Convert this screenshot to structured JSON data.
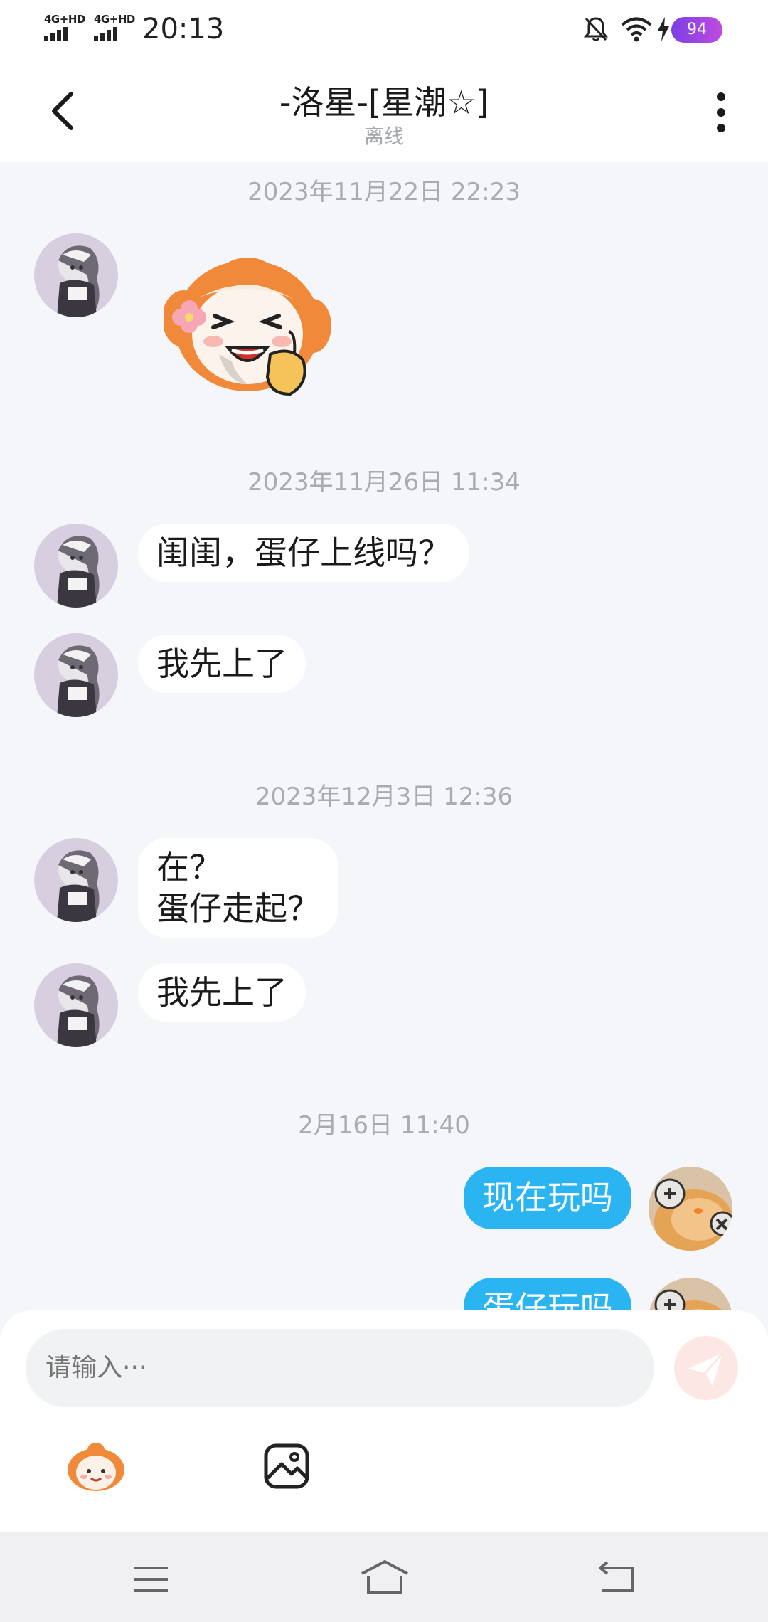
{
  "status_bar": {
    "network_1": "4G+HD",
    "network_2": "4G+HD",
    "time": "20:13",
    "battery": "94",
    "icons": [
      "bell-off-icon",
      "wifi-icon",
      "bolt-icon",
      "battery-icon"
    ]
  },
  "header": {
    "title": "-洛星-[星潮☆]",
    "subtitle": "离线",
    "back_icon": "chevron-left-icon",
    "more_icon": "more-vertical-icon"
  },
  "timestamps": [
    "2023年11月22日 22:23",
    "2023年11月26日 11:34",
    "2023年12月3日 12:36",
    "2月16日 11:40"
  ],
  "messages": [
    {
      "from": "other",
      "type": "sticker",
      "sticker": "laughing-orange-mascot"
    },
    {
      "from": "other",
      "type": "text",
      "text": "闺闺，蛋仔上线吗？"
    },
    {
      "from": "other",
      "type": "text",
      "text": "我先上了"
    },
    {
      "from": "other",
      "type": "text",
      "lines": [
        "在？",
        "蛋仔走起？"
      ]
    },
    {
      "from": "other",
      "type": "text",
      "text": "我先上了"
    },
    {
      "from": "me",
      "type": "text",
      "text": "现在玩吗"
    },
    {
      "from": "me",
      "type": "text",
      "text": "蛋仔玩吗"
    }
  ],
  "input": {
    "placeholder": "请输入···"
  },
  "toolbar": {
    "items": [
      "emoji-mascot-icon",
      "image-icon"
    ]
  },
  "system_nav": [
    "menu-icon",
    "home-icon",
    "return-icon"
  ],
  "colors": {
    "chat_background": "#f4f6f9",
    "my_bubble": "#2bb4f2",
    "other_bubble": "#ffffff",
    "send_button": "#fde7e5",
    "battery": "#a24be2"
  }
}
